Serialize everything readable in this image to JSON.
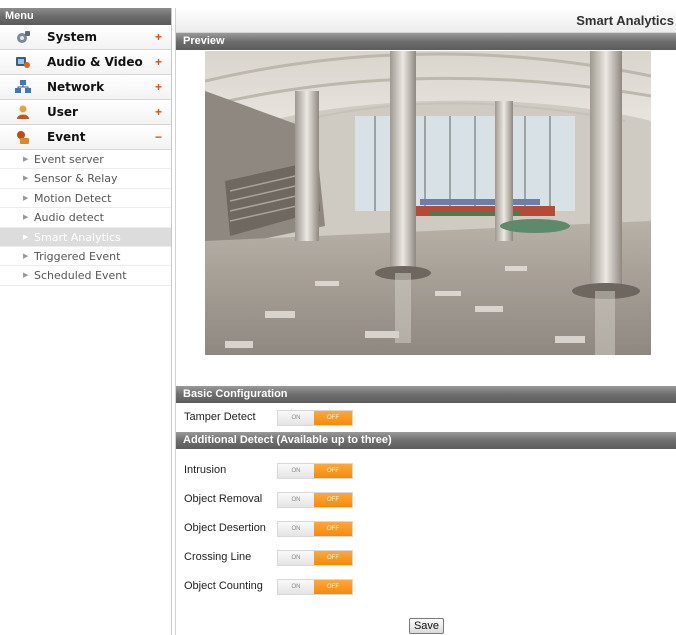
{
  "menu": {
    "header": "Menu",
    "items": [
      {
        "label": "System",
        "sign": "+",
        "icon": "system-icon"
      },
      {
        "label": "Audio & Video",
        "sign": "+",
        "icon": "audio-video-icon"
      },
      {
        "label": "Network",
        "sign": "+",
        "icon": "network-icon"
      },
      {
        "label": "User",
        "sign": "+",
        "icon": "user-icon"
      },
      {
        "label": "Event",
        "sign": "−",
        "icon": "event-icon"
      }
    ],
    "sub_items": [
      {
        "label": "Event server",
        "active": false
      },
      {
        "label": "Sensor & Relay",
        "active": false
      },
      {
        "label": "Motion Detect",
        "active": false
      },
      {
        "label": "Audio detect",
        "active": false
      },
      {
        "label": "Smart Analytics",
        "active": true
      },
      {
        "label": "Triggered Event",
        "active": false
      },
      {
        "label": "Scheduled Event",
        "active": false
      }
    ],
    "arrow_glyph": "▶"
  },
  "page": {
    "title": "Smart Analytics",
    "preview_header": "Preview",
    "basic_header": "Basic Configuration",
    "additional_header": "Additional Detect (Available up to three)",
    "save_label": "Save"
  },
  "basic_settings": [
    {
      "label": "Tamper Detect",
      "on_label": "ON",
      "off_label": "OFF",
      "value": "OFF"
    }
  ],
  "additional_settings": [
    {
      "label": "Intrusion",
      "on_label": "ON",
      "off_label": "OFF",
      "value": "OFF"
    },
    {
      "label": "Object Removal",
      "on_label": "ON",
      "off_label": "OFF",
      "value": "OFF"
    },
    {
      "label": "Object Desertion",
      "on_label": "ON",
      "off_label": "OFF",
      "value": "OFF"
    },
    {
      "label": "Crossing Line",
      "on_label": "ON",
      "off_label": "OFF",
      "value": "OFF"
    },
    {
      "label": "Object Counting",
      "on_label": "ON",
      "off_label": "OFF",
      "value": "OFF"
    }
  ],
  "colors": {
    "accent_off": "#f48a0a",
    "header_gray": "#6e6e6e",
    "menu_sign": "#e04e10"
  }
}
